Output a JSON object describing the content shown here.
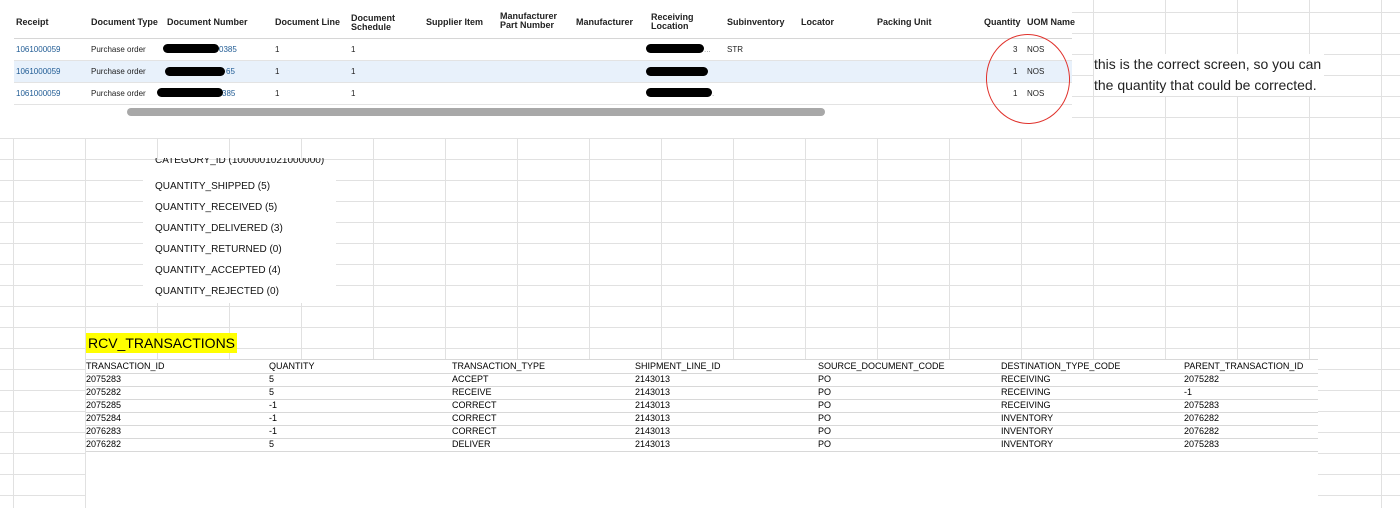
{
  "top_table": {
    "headers": {
      "receipt": "Receipt",
      "document_type": "Document Type",
      "document_number": "Document Number",
      "document_line": "Document Line",
      "document_schedule": "Document\nSchedule",
      "supplier_item": "Supplier Item",
      "manufacturer_part_number": "Manufacturer\nPart Number",
      "manufacturer": "Manufacturer",
      "receiving_location": "Receiving\nLocation",
      "subinventory": "Subinventory",
      "locator": "Locator",
      "packing_unit": "Packing Unit",
      "quantity": "Quantity",
      "uom_name": "UOM Name"
    },
    "rows": [
      {
        "receipt": "1061000059",
        "document_type": "Purchase order",
        "doc_number_visible": "0385",
        "document_line": "1",
        "document_schedule": "1",
        "location_suffix": "...",
        "subinventory": "STR",
        "quantity": "3",
        "uom": "NOS"
      },
      {
        "receipt": "1061000059",
        "document_type": "Purchase order",
        "doc_number_visible": "65",
        "document_line": "1",
        "document_schedule": "1",
        "location_suffix": "",
        "subinventory": "",
        "quantity": "1",
        "uom": "NOS"
      },
      {
        "receipt": "1061000059",
        "document_type": "Purchase order",
        "doc_number_visible": "385",
        "document_line": "1",
        "document_schedule": "1",
        "location_suffix": ".",
        "subinventory": "",
        "quantity": "1",
        "uom": "NOS"
      }
    ]
  },
  "note": "this is the correct screen, so you can the quantity that could be corrected.",
  "quantity_list": [
    "CATEGORY_ID (1000001021000000)",
    "QUANTITY_SHIPPED (5)",
    "QUANTITY_RECEIVED (5)",
    "QUANTITY_DELIVERED (3)",
    "QUANTITY_RETURNED (0)",
    "QUANTITY_ACCEPTED (4)",
    "QUANTITY_REJECTED (0)"
  ],
  "rcv_title": "RCV_TRANSACTIONS",
  "transactions": {
    "headers": [
      "TRANSACTION_ID",
      "QUANTITY",
      "TRANSACTION_TYPE",
      "SHIPMENT_LINE_ID",
      "SOURCE_DOCUMENT_CODE",
      "DESTINATION_TYPE_CODE",
      "PARENT_TRANSACTION_ID"
    ],
    "rows": [
      [
        "2075283",
        "5",
        "ACCEPT",
        "2143013",
        "PO",
        "RECEIVING",
        "2075282"
      ],
      [
        "2075282",
        "5",
        "RECEIVE",
        "2143013",
        "PO",
        "RECEIVING",
        "-1"
      ],
      [
        "2075285",
        "-1",
        "CORRECT",
        "2143013",
        "PO",
        "RECEIVING",
        "2075283"
      ],
      [
        "2075284",
        "-1",
        "CORRECT",
        "2143013",
        "PO",
        "INVENTORY",
        "2076282"
      ],
      [
        "2076283",
        "-1",
        "CORRECT",
        "2143013",
        "PO",
        "INVENTORY",
        "2076282"
      ],
      [
        "2076282",
        "5",
        "DELIVER",
        "2143013",
        "PO",
        "INVENTORY",
        "2075283"
      ]
    ]
  },
  "colors": {
    "link": "#1f5b94",
    "highlight": "#ffff00",
    "annotation": "#e0322c",
    "selected_row": "#e8f1fb"
  }
}
